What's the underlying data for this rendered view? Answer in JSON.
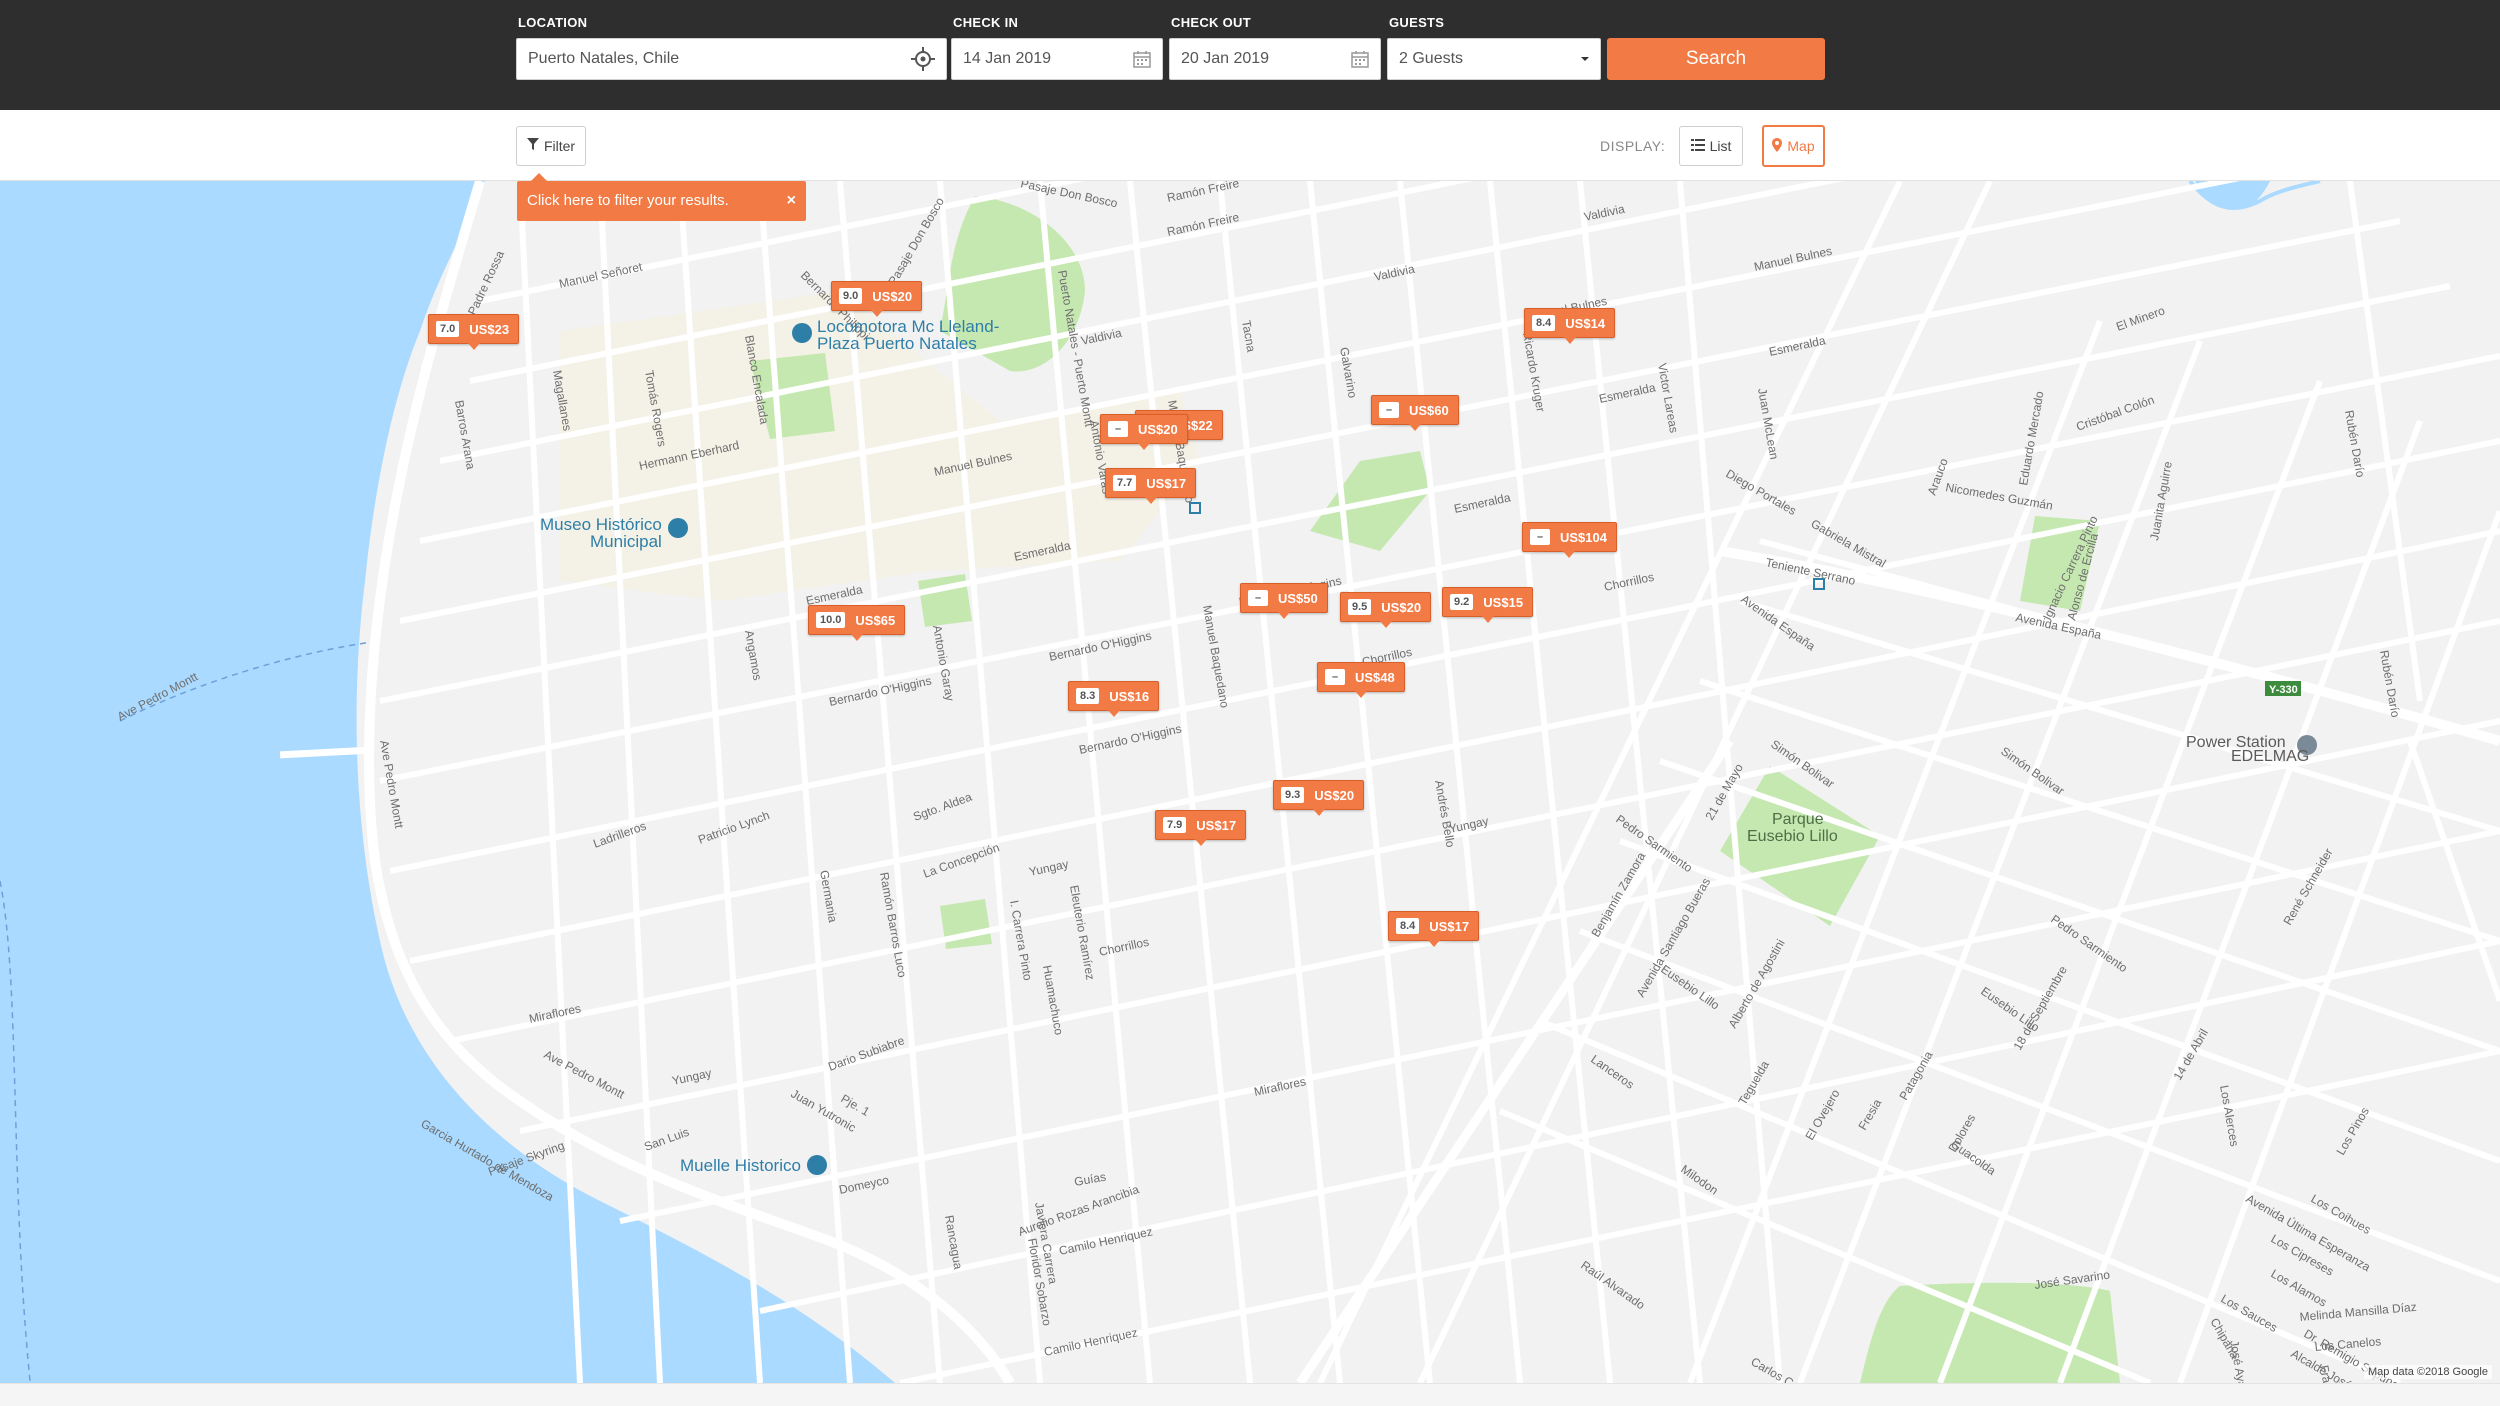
{
  "search": {
    "location_label": "LOCATION",
    "location_value": "Puerto Natales, Chile",
    "checkin_label": "CHECK IN",
    "checkin_value": "14 Jan 2019",
    "checkout_label": "CHECK OUT",
    "checkout_value": "20 Jan 2019",
    "guests_label": "GUESTS",
    "guests_value": "2 Guests",
    "search_label": "Search"
  },
  "toolbar": {
    "filter_label": "Filter",
    "display_label": "DISPLAY:",
    "list_label": "List",
    "map_label": "Map",
    "tooltip_text": "Click here to filter your results.",
    "tooltip_close": "×"
  },
  "map": {
    "attribution": "Map data ©2018 Google",
    "pois": [
      "Locomotora Mc Lleland-",
      "Plaza Puerto Natales",
      "Museo Histórico",
      "Municipal",
      "Muelle Historico",
      "Power Station",
      "EDELMAG"
    ],
    "parks": [
      "Parque",
      "Eusebio Lillo"
    ],
    "route_badge": "Y-330",
    "streets": [
      "Pasaje Don Bosco",
      "Ramón Freire",
      "Ramón Freire",
      "Valdivia",
      "Valdivia",
      "Valdivia",
      "Manuel Señoret",
      "Bernardo Philippi",
      "Pasaje Don Bosco",
      "Manuel Bulnes",
      "Manuel Bulnes",
      "Hermann Eberhard",
      "Manuel Bulnes",
      "Esmeralda",
      "Esmeralda",
      "Esmeralda",
      "Esmeralda",
      "Esmeralda",
      "Bernardo O'Higgins",
      "Bernardo O'Higgins",
      "Bernardo O'Higgins",
      "Bernardo O'Higgins",
      "Chorrillos",
      "Chorrillos",
      "Chorrillos",
      "Yungay",
      "Yungay",
      "Yungay",
      "Miraflores",
      "Miraflores",
      "Domeyco",
      "Camilo Henriquez",
      "Camilo Henriquez",
      "Teniente Serrano",
      "Avenida España",
      "Avenida España",
      "Simón Bolivar",
      "Simón Bolivar",
      "Pedro Sarmiento",
      "Pedro Sarmiento",
      "Eusebio Lillo",
      "Eusebio Lillo",
      "Lanceros",
      "Milodon",
      "Guacolda",
      "José Savarino",
      "Raúl Alvarado",
      "Carlos Condell",
      "Padre Rossa",
      "Ave Pedro Montt",
      "Ave Pedro Montt",
      "Ave Pedro Montt",
      "Puerto Natales - Puerto Montt",
      "Manuel Baquedano",
      "Manuel Baquedano",
      "Eleuterio Ramírez",
      "Blanco Encalada",
      "Tomás Rogers",
      "Magallanes",
      "Barros Arana",
      "Ladrilleros",
      "Patricio Lynch",
      "Sgto. Aldea",
      "La Concepción",
      "Germania",
      "Ramón Barros Luco",
      "I. Carrera Pinto",
      "Huamachuco",
      "Tacna",
      "Galvarino",
      "Ricardo Kruger",
      "Victor Lareas",
      "Juan McLean",
      "Andrés Bello",
      "Benjamín Zamora",
      "Avenida Santiago Bueras",
      "21 de Mayo",
      "Alberto de Agostini",
      "Teguelda",
      "El Ovejero",
      "Fresia",
      "Patagonia",
      "18 de Septiembre",
      "14 de Abril",
      "René Schneider",
      "Los Pinos",
      "Los Alerces",
      "Dolores",
      "Rancagua",
      "Floridor Sobarzo",
      "Dario Subiabre",
      "Juan Yutronic",
      "Pje. 1",
      "San Luis",
      "Pasaje Skyring",
      "Garcia Hurtado de Mendoza",
      "Aurelio Rozas Arancibia",
      "Gabriela Mistral",
      "Diego Portales",
      "Nicomedes Guzmán",
      "Eduardo Mercado",
      "Cristóbal Colón",
      "El Minero",
      "Rubén Darío",
      "Rubén Darío",
      "Avenida Última Esperanza",
      "Los Coihues",
      "Los Cipreses",
      "Los Alamos",
      "Los Sauces",
      "Alcalde José Muñoz",
      "Dr. Luis Lozic",
      "Dr. Remigio Sapunar",
      "Francisco Aros P",
      "José Ayaquintuy Moris",
      "Melinda Mansilla Díaz",
      "Los Canelos",
      "Chipana",
      "Guías",
      "Javiera Carrera",
      "Juanita Aguirre",
      "Arauco",
      "Alonso de Ercilla",
      "Ignacio Carrera Pinto",
      "Angamos",
      "Antonio Varas",
      "Antonio Garay"
    ]
  },
  "markers": [
    {
      "rating": "7.0",
      "price": "US$23"
    },
    {
      "rating": "9.0",
      "price": "US$20"
    },
    {
      "rating": "8.4",
      "price": "US$14"
    },
    {
      "rating": "–",
      "price": "US$60"
    },
    {
      "rating": "–",
      "price": "US$22"
    },
    {
      "rating": "–",
      "price": "US$20"
    },
    {
      "rating": "7.7",
      "price": "US$17"
    },
    {
      "rating": "–",
      "price": "US$104"
    },
    {
      "rating": "10.0",
      "price": "US$65"
    },
    {
      "rating": "–",
      "price": "US$50"
    },
    {
      "rating": "9.5",
      "price": "US$20"
    },
    {
      "rating": "9.2",
      "price": "US$15"
    },
    {
      "rating": "–",
      "price": "US$48"
    },
    {
      "rating": "8.3",
      "price": "US$16"
    },
    {
      "rating": "9.3",
      "price": "US$20"
    },
    {
      "rating": "7.9",
      "price": "US$17"
    },
    {
      "rating": "8.4",
      "price": "US$17"
    }
  ],
  "colors": {
    "accent": "#f27a45",
    "topbar": "#2e2e2e",
    "water": "#aadaff",
    "park": "#c5e8b0",
    "land": "#f2f2f2",
    "road": "#ffffff",
    "poi": "#2e7fa8"
  },
  "icons": {
    "locate": "crosshair-icon",
    "calendar": "calendar-icon",
    "dropdown": "caret-down-icon",
    "filter": "funnel-icon",
    "list": "list-icon",
    "map": "map-pin-icon"
  }
}
